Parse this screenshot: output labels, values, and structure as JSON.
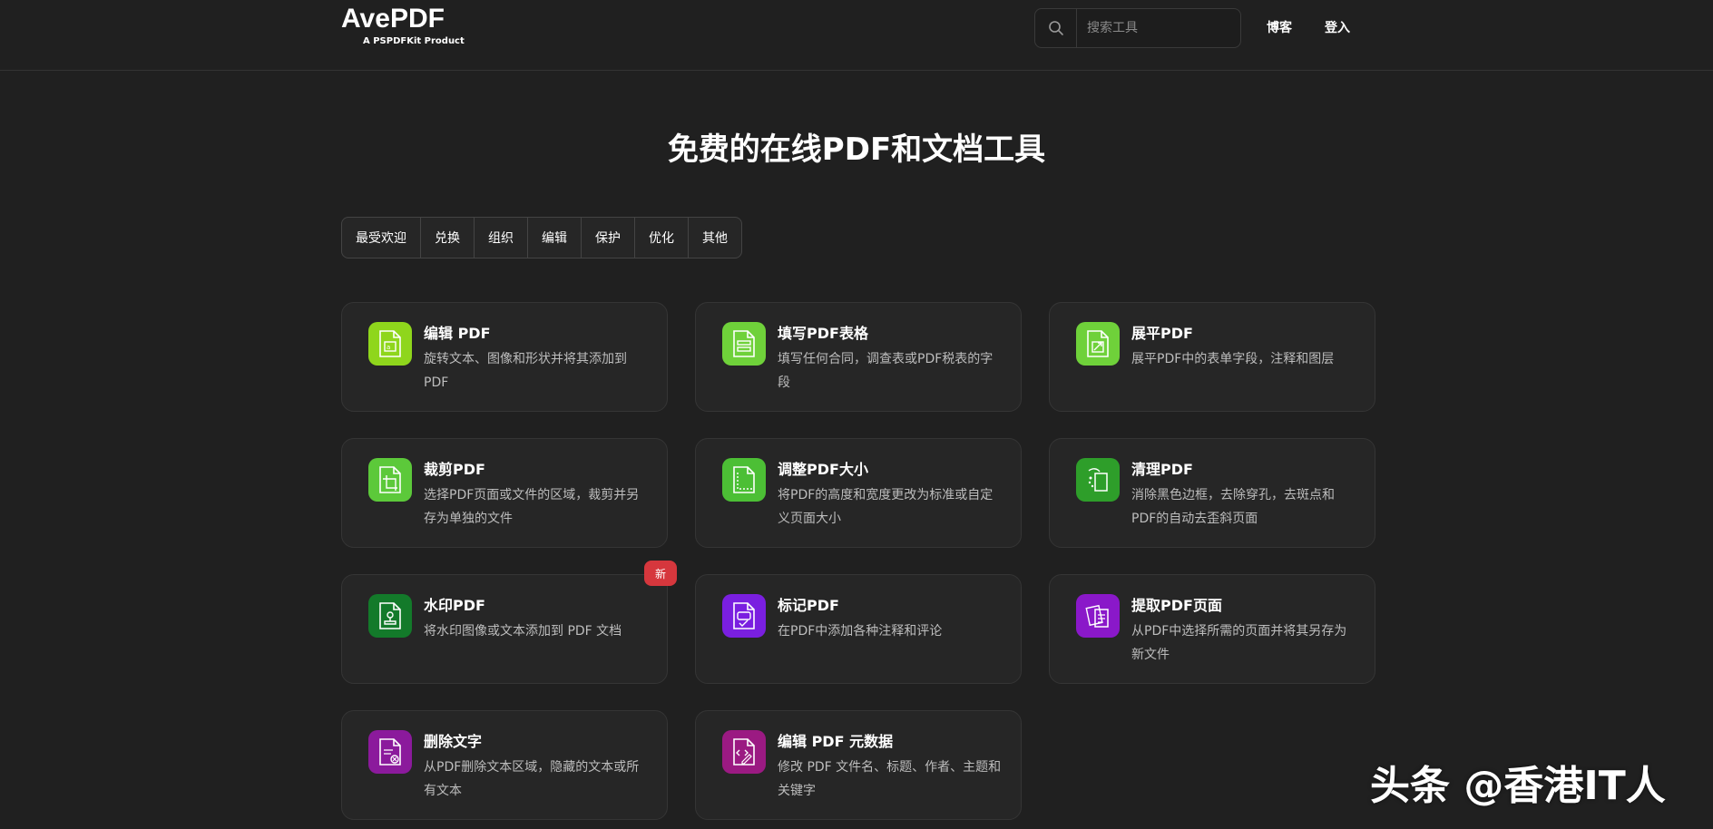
{
  "header": {
    "logo_text": "AvePDF",
    "logo_sub": "A PSPDFKit Product",
    "search_placeholder": "搜索工具",
    "nav": {
      "blog": "博客",
      "login": "登入"
    }
  },
  "main": {
    "title": "免费的在线PDF和文档工具",
    "tabs": [
      {
        "label": "最受欢迎"
      },
      {
        "label": "兑换"
      },
      {
        "label": "组织"
      },
      {
        "label": "编辑"
      },
      {
        "label": "保护"
      },
      {
        "label": "优化"
      },
      {
        "label": "其他"
      }
    ],
    "cards": [
      {
        "title": "编辑 PDF",
        "desc": "旋转文本、图像和形状并将其添加到 PDF",
        "icon": "edit-pdf-icon",
        "color": "#8fd61c"
      },
      {
        "title": "填写PDF表格",
        "desc": "填写任何合同，调查表或PDF税表的字段",
        "icon": "fill-form-icon",
        "color": "#6fd13a"
      },
      {
        "title": "展平PDF",
        "desc": "展平PDF中的表单字段，注释和图层",
        "icon": "flatten-pdf-icon",
        "color": "#6fd13a"
      },
      {
        "title": "裁剪PDF",
        "desc": "选择PDF页面或文件的区域，裁剪并另存为单独的文件",
        "icon": "crop-pdf-icon",
        "color": "#5cc93a"
      },
      {
        "title": "调整PDF大小",
        "desc": "将PDF的高度和宽度更改为标准或自定义页面大小",
        "icon": "resize-pdf-icon",
        "color": "#4cbf35"
      },
      {
        "title": "清理PDF",
        "desc": "消除黑色边框，去除穿孔，去斑点和PDF的自动去歪斜页面",
        "icon": "clean-pdf-icon",
        "color": "#2e9e2a"
      },
      {
        "title": "水印PDF",
        "desc": "将水印图像或文本添加到 PDF 文档",
        "icon": "watermark-pdf-icon",
        "color": "#137a2a",
        "badge": "新"
      },
      {
        "title": "标记PDF",
        "desc": "在PDF中添加各种注释和评论",
        "icon": "markup-pdf-icon",
        "color": "#7a1fe0"
      },
      {
        "title": "提取PDF页面",
        "desc": "从PDF中选择所需的页面并将其另存为新文件",
        "icon": "extract-pages-icon",
        "color": "#8a18c9"
      },
      {
        "title": "删除文字",
        "desc": "从PDF删除文本区域，隐藏的文本或所有文本",
        "icon": "redact-text-icon",
        "color": "#8b1a9c"
      },
      {
        "title": "编辑 PDF 元数据",
        "desc": "修改 PDF 文件名、标题、作者、主题和关键字",
        "icon": "edit-metadata-icon",
        "color": "#9b1a82"
      }
    ]
  },
  "watermark": "头条 @香港IT人"
}
